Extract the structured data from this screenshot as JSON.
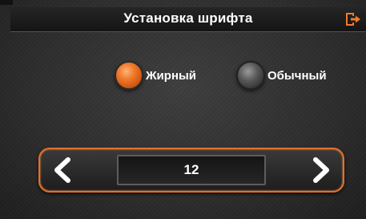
{
  "header": {
    "title": "Установка шрифта",
    "exit_icon": "exit-icon"
  },
  "font_style": {
    "options": [
      {
        "label": "Жирный",
        "selected": true
      },
      {
        "label": "Обычный",
        "selected": false
      }
    ]
  },
  "font_size": {
    "value": "12",
    "decrease_icon": "arrow-left-icon",
    "increase_icon": "arrow-right-icon"
  },
  "colors": {
    "accent": "#f07a2a",
    "background": "#2c2c2c",
    "text": "#ffffff"
  }
}
